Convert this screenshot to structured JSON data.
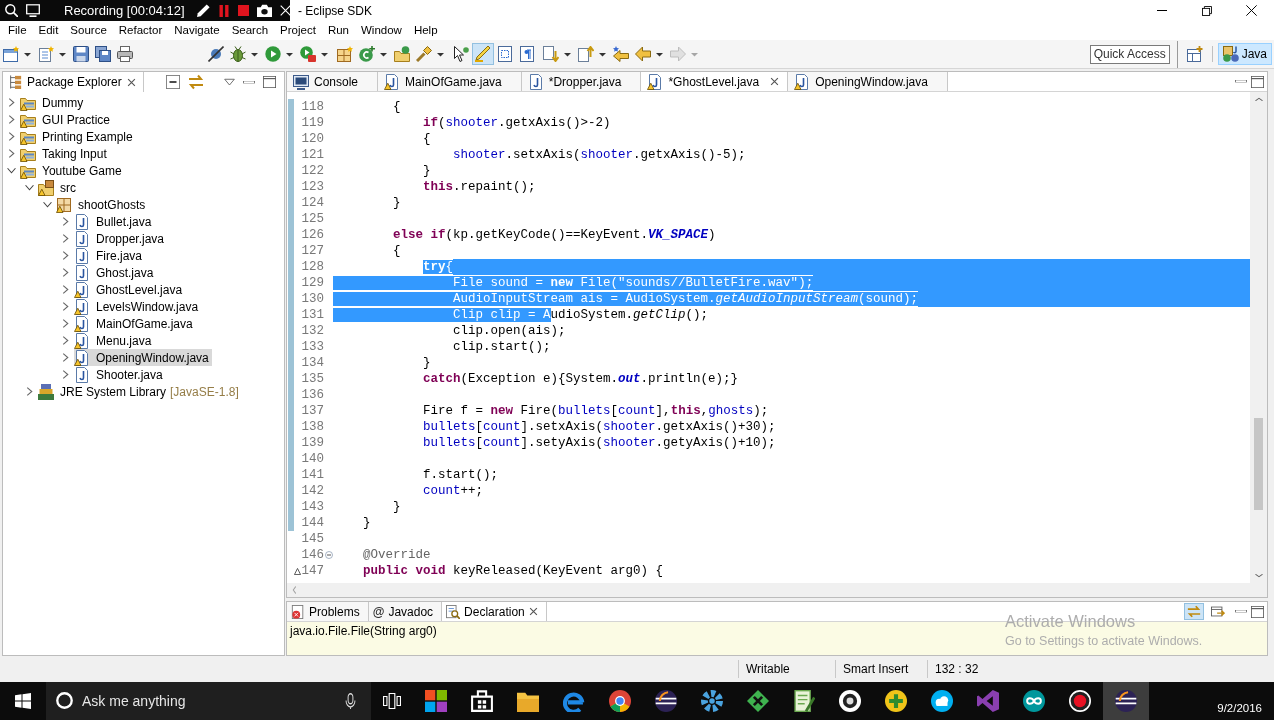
{
  "recorder": {
    "title": "Recording [00:04:12]"
  },
  "window": {
    "title": "- Eclipse SDK"
  },
  "menu": [
    "File",
    "Edit",
    "Source",
    "Refactor",
    "Navigate",
    "Search",
    "Project",
    "Run",
    "Window",
    "Help"
  ],
  "toolbar": [
    {
      "items": [
        {
          "kind": "new-wizard",
          "pressed": false,
          "disabled": false
        },
        {
          "kind": "new-file",
          "pressed": false,
          "disabled": false
        },
        {
          "kind": "save",
          "pressed": false,
          "disabled": false
        },
        {
          "kind": "save-all",
          "pressed": false,
          "disabled": false
        },
        {
          "kind": "print",
          "pressed": false,
          "disabled": false
        }
      ]
    },
    {
      "items": [
        {
          "kind": "skip-breakpoints",
          "pressed": false,
          "disabled": false
        },
        {
          "kind": "debug",
          "pressed": false,
          "disabled": false
        },
        {
          "kind": "run",
          "pressed": false,
          "disabled": false
        },
        {
          "kind": "external-tools",
          "pressed": false,
          "disabled": false
        }
      ]
    },
    {
      "items": [
        {
          "kind": "new-package",
          "pressed": false,
          "disabled": false
        },
        {
          "kind": "new-class",
          "pressed": false,
          "disabled": false
        },
        {
          "kind": "open-type",
          "pressed": false,
          "disabled": false
        },
        {
          "kind": "search",
          "pressed": false,
          "disabled": false
        }
      ]
    },
    {
      "items": [
        {
          "kind": "pointer",
          "pressed": false,
          "disabled": false
        },
        {
          "kind": "mark-occurrences",
          "pressed": true,
          "disabled": false
        },
        {
          "kind": "block-selection",
          "pressed": false,
          "disabled": false
        },
        {
          "kind": "whitespace",
          "pressed": false,
          "disabled": false
        }
      ]
    },
    {
      "items": [
        {
          "kind": "next-annotation",
          "pressed": false,
          "disabled": false
        },
        {
          "kind": "previous-annotation",
          "pressed": false,
          "disabled": false
        },
        {
          "kind": "last-edit",
          "pressed": false,
          "disabled": false
        },
        {
          "kind": "back",
          "pressed": false,
          "disabled": false
        },
        {
          "kind": "forward",
          "pressed": false,
          "disabled": true
        }
      ]
    }
  ],
  "quick_access": {
    "placeholder": "Quick Access"
  },
  "perspectives": [
    {
      "label": "Java",
      "selected": true
    }
  ],
  "package_explorer": {
    "title": "Package Explorer",
    "tree": [
      {
        "label": "Dummy",
        "kind": "project",
        "expanded": false,
        "selected": false,
        "warning": true
      },
      {
        "label": "GUI Practice",
        "kind": "project",
        "expanded": false,
        "selected": false,
        "warning": true
      },
      {
        "label": "Printing Example",
        "kind": "project",
        "expanded": false,
        "selected": false,
        "warning": true
      },
      {
        "label": "Taking Input",
        "kind": "project",
        "expanded": false,
        "selected": false,
        "warning": true
      },
      {
        "label": "Youtube Game",
        "kind": "project",
        "expanded": true,
        "selected": false,
        "warning": true,
        "children": [
          {
            "label": "src",
            "kind": "source-folder",
            "expanded": true,
            "selected": false,
            "warning": true,
            "children": [
              {
                "label": "shootGhosts",
                "kind": "package",
                "expanded": true,
                "selected": false,
                "warning": true,
                "children": [
                  {
                    "label": "Bullet.java",
                    "kind": "java-file",
                    "expanded": false,
                    "selected": false,
                    "warning": false
                  },
                  {
                    "label": "Dropper.java",
                    "kind": "java-file",
                    "expanded": false,
                    "selected": false,
                    "warning": false
                  },
                  {
                    "label": "Fire.java",
                    "kind": "java-file",
                    "expanded": false,
                    "selected": false,
                    "warning": false
                  },
                  {
                    "label": "Ghost.java",
                    "kind": "java-file",
                    "expanded": false,
                    "selected": false,
                    "warning": false
                  },
                  {
                    "label": "GhostLevel.java",
                    "kind": "java-file",
                    "expanded": false,
                    "selected": false,
                    "warning": true
                  },
                  {
                    "label": "LevelsWindow.java",
                    "kind": "java-file",
                    "expanded": false,
                    "selected": false,
                    "warning": true
                  },
                  {
                    "label": "MainOfGame.java",
                    "kind": "java-file",
                    "expanded": false,
                    "selected": false,
                    "warning": true
                  },
                  {
                    "label": "Menu.java",
                    "kind": "java-file",
                    "expanded": false,
                    "selected": false,
                    "warning": true
                  },
                  {
                    "label": "OpeningWindow.java",
                    "kind": "java-file",
                    "expanded": false,
                    "selected": true,
                    "warning": true
                  },
                  {
                    "label": "Shooter.java",
                    "kind": "java-file",
                    "expanded": false,
                    "selected": false,
                    "warning": false
                  }
                ]
              }
            ]
          },
          {
            "label": "JRE System Library",
            "decoration": "[JavaSE-1.8]",
            "kind": "library",
            "expanded": false,
            "selected": false,
            "warning": false
          }
        ]
      }
    ]
  },
  "editor": {
    "tabs": [
      {
        "label": "Console",
        "kind": "console",
        "warning": false,
        "selected": false
      },
      {
        "label": "MainOfGame.java",
        "kind": "java",
        "warning": true,
        "selected": false
      },
      {
        "label": "*Dropper.java",
        "kind": "java",
        "warning": false,
        "selected": false
      },
      {
        "label": "*GhostLevel.java",
        "kind": "java",
        "warning": true,
        "selected": true
      },
      {
        "label": "OpeningWindow.java",
        "kind": "java",
        "warning": true,
        "selected": false
      }
    ],
    "blocks": [
      {
        "range_marked": true,
        "lines": [
          {
            "number": "118",
            "fold_marker": false,
            "override_marker": false,
            "segments": [
              {
                "kind": "plain",
                "text": "\t\t{",
                "selected": false
              }
            ]
          },
          {
            "number": "119",
            "fold_marker": false,
            "override_marker": false,
            "segments": [
              {
                "kind": "keyword",
                "text": "\t\t\tif",
                "selected": false
              },
              {
                "kind": "plain",
                "text": "(",
                "selected": false
              },
              {
                "kind": "field",
                "text": "shooter",
                "selected": false
              },
              {
                "kind": "plain",
                "text": ".getxAxis()>-2)",
                "selected": false
              }
            ]
          },
          {
            "number": "120",
            "fold_marker": false,
            "override_marker": false,
            "segments": [
              {
                "kind": "plain",
                "text": "\t\t\t{",
                "selected": false
              }
            ]
          },
          {
            "number": "121",
            "fold_marker": false,
            "override_marker": false,
            "segments": [
              {
                "kind": "field",
                "text": "\t\t\t\tshooter",
                "selected": false
              },
              {
                "kind": "plain",
                "text": ".setxAxis(",
                "selected": false
              },
              {
                "kind": "field",
                "text": "shooter",
                "selected": false
              },
              {
                "kind": "plain",
                "text": ".getxAxis()-5);",
                "selected": false
              }
            ]
          },
          {
            "number": "122",
            "fold_marker": false,
            "override_marker": false,
            "segments": [
              {
                "kind": "plain",
                "text": "\t\t\t}",
                "selected": false
              }
            ]
          },
          {
            "number": "123",
            "fold_marker": false,
            "override_marker": false,
            "segments": [
              {
                "kind": "keyword",
                "text": "\t\t\tthis",
                "selected": false
              },
              {
                "kind": "plain",
                "text": ".repaint();",
                "selected": false
              }
            ]
          },
          {
            "number": "124",
            "fold_marker": false,
            "override_marker": false,
            "segments": [
              {
                "kind": "plain",
                "text": "\t\t}",
                "selected": false
              }
            ]
          },
          {
            "number": "125",
            "fold_marker": false,
            "override_marker": false
          },
          {
            "number": "126",
            "fold_marker": false,
            "override_marker": false,
            "segments": [
              {
                "kind": "keyword",
                "text": "\t\telse if",
                "selected": false
              },
              {
                "kind": "plain",
                "text": "(kp.getKeyCode()==KeyEvent.",
                "selected": false
              },
              {
                "kind": "static-field",
                "text": "VK_SPACE",
                "selected": false
              },
              {
                "kind": "plain",
                "text": ")",
                "selected": false
              }
            ]
          },
          {
            "number": "127",
            "fold_marker": false,
            "override_marker": false,
            "segments": [
              {
                "kind": "plain",
                "text": "\t\t{",
                "selected": false
              }
            ]
          },
          {
            "number": "128",
            "fold_marker": false,
            "override_marker": false,
            "segments": [
              {
                "kind": "keyword",
                "text": "\t\t\ttry",
                "selected": true
              },
              {
                "kind": "plain",
                "text": "{",
                "selected": true
              }
            ]
          },
          {
            "number": "129",
            "fold_marker": false,
            "override_marker": false,
            "segments": [
              {
                "kind": "plain",
                "text": "\t\t\t\tFile sound = ",
                "selected": true
              },
              {
                "kind": "keyword",
                "text": "new",
                "selected": true
              },
              {
                "kind": "plain",
                "text": " File(",
                "selected": true
              },
              {
                "kind": "string",
                "text": "\"sounds//BulletFire.wav\"",
                "selected": true
              },
              {
                "kind": "plain",
                "text": ");",
                "selected": true
              }
            ]
          },
          {
            "number": "130",
            "fold_marker": false,
            "override_marker": false,
            "segments": [
              {
                "kind": "plain",
                "text": "\t\t\t\tAudioInputStream ais = AudioSystem.",
                "selected": true
              },
              {
                "kind": "static-method",
                "text": "getAudioInputStream",
                "selected": true
              },
              {
                "kind": "plain",
                "text": "(sound);",
                "selected": true
              }
            ]
          },
          {
            "number": "131",
            "fold_marker": false,
            "override_marker": false,
            "segments": [
              {
                "kind": "plain",
                "text": "\t\t\t\tClip clip = A",
                "selected": true
              },
              {
                "kind": "plain",
                "text": "udioSystem.",
                "selected": false
              },
              {
                "kind": "static-method",
                "text": "getClip",
                "selected": false
              },
              {
                "kind": "plain",
                "text": "();",
                "selected": false
              }
            ]
          },
          {
            "number": "132",
            "fold_marker": false,
            "override_marker": false,
            "segments": [
              {
                "kind": "plain",
                "text": "\t\t\t\tclip.open(ais);",
                "selected": false
              }
            ]
          },
          {
            "number": "133",
            "fold_marker": false,
            "override_marker": false,
            "segments": [
              {
                "kind": "plain",
                "text": "\t\t\t\tclip.start();",
                "selected": false
              }
            ]
          },
          {
            "number": "134",
            "fold_marker": false,
            "override_marker": false,
            "segments": [
              {
                "kind": "plain",
                "text": "\t\t\t}",
                "selected": false
              }
            ]
          },
          {
            "number": "135",
            "fold_marker": false,
            "override_marker": false,
            "segments": [
              {
                "kind": "keyword",
                "text": "\t\t\tcatch",
                "selected": false
              },
              {
                "kind": "plain",
                "text": "(Exception e){System.",
                "selected": false
              },
              {
                "kind": "static-field",
                "text": "out",
                "selected": false
              },
              {
                "kind": "plain",
                "text": ".println(e);}",
                "selected": false
              }
            ]
          },
          {
            "number": "136",
            "fold_marker": false,
            "override_marker": false
          },
          {
            "number": "137",
            "fold_marker": false,
            "override_marker": false,
            "segments": [
              {
                "kind": "plain",
                "text": "\t\t\tFire f = ",
                "selected": false
              },
              {
                "kind": "keyword",
                "text": "new",
                "selected": false
              },
              {
                "kind": "plain",
                "text": " Fire(",
                "selected": false
              },
              {
                "kind": "field",
                "text": "bullets",
                "selected": false
              },
              {
                "kind": "plain",
                "text": "[",
                "selected": false
              },
              {
                "kind": "field",
                "text": "count",
                "selected": false
              },
              {
                "kind": "plain",
                "text": "],",
                "selected": false
              },
              {
                "kind": "keyword",
                "text": "this",
                "selected": false
              },
              {
                "kind": "plain",
                "text": ",",
                "selected": false
              },
              {
                "kind": "field",
                "text": "ghosts",
                "selected": false
              },
              {
                "kind": "plain",
                "text": ");",
                "selected": false
              }
            ]
          },
          {
            "number": "138",
            "fold_marker": false,
            "override_marker": false,
            "segments": [
              {
                "kind": "field",
                "text": "\t\t\tbullets",
                "selected": false
              },
              {
                "kind": "plain",
                "text": "[",
                "selected": false
              },
              {
                "kind": "field",
                "text": "count",
                "selected": false
              },
              {
                "kind": "plain",
                "text": "].setxAxis(",
                "selected": false
              },
              {
                "kind": "field",
                "text": "shooter",
                "selected": false
              },
              {
                "kind": "plain",
                "text": ".getxAxis()+30);",
                "selected": false
              }
            ]
          },
          {
            "number": "139",
            "fold_marker": false,
            "override_marker": false,
            "segments": [
              {
                "kind": "field",
                "text": "\t\t\tbullets",
                "selected": false
              },
              {
                "kind": "plain",
                "text": "[",
                "selected": false
              },
              {
                "kind": "field",
                "text": "count",
                "selected": false
              },
              {
                "kind": "plain",
                "text": "].setyAxis(",
                "selected": false
              },
              {
                "kind": "field",
                "text": "shooter",
                "selected": false
              },
              {
                "kind": "plain",
                "text": ".getyAxis()+10);",
                "selected": false
              }
            ]
          },
          {
            "number": "140",
            "fold_marker": false,
            "override_marker": false
          },
          {
            "number": "141",
            "fold_marker": false,
            "override_marker": false,
            "segments": [
              {
                "kind": "plain",
                "text": "\t\t\tf.start();",
                "selected": false
              }
            ]
          },
          {
            "number": "142",
            "fold_marker": false,
            "override_marker": false,
            "segments": [
              {
                "kind": "field",
                "text": "\t\t\tcount",
                "selected": false
              },
              {
                "kind": "plain",
                "text": "++;",
                "selected": false
              }
            ]
          },
          {
            "number": "143",
            "fold_marker": false,
            "override_marker": false,
            "segments": [
              {
                "kind": "plain",
                "text": "\t\t}",
                "selected": false
              }
            ]
          },
          {
            "number": "144",
            "fold_marker": false,
            "override_marker": false,
            "segments": [
              {
                "kind": "plain",
                "text": "\t}",
                "selected": false
              }
            ]
          }
        ]
      },
      {
        "range_marked": false,
        "lines": [
          {
            "number": "145",
            "fold_marker": false,
            "override_marker": false
          },
          {
            "number": "146",
            "fold_marker": true,
            "override_marker": false,
            "segments": [
              {
                "kind": "annotation",
                "text": "\t@Override",
                "selected": false
              }
            ]
          },
          {
            "number": "147",
            "fold_marker": false,
            "override_marker": true,
            "segments": [
              {
                "kind": "keyword",
                "text": "\tpublic void",
                "selected": false
              },
              {
                "kind": "plain",
                "text": " keyReleased(KeyEvent arg0) {",
                "selected": false
              }
            ]
          }
        ]
      }
    ]
  },
  "bottom_panel": {
    "tabs": [
      {
        "label": "Problems",
        "kind": "problems",
        "selected": false
      },
      {
        "label": "Javadoc",
        "kind": "javadoc",
        "glyph": "@",
        "selected": false
      },
      {
        "label": "Declaration",
        "kind": "declaration",
        "selected": true
      }
    ],
    "tools": [
      {
        "kind": "link",
        "pressed": true
      },
      {
        "kind": "open-input",
        "pressed": false
      }
    ],
    "content": "java.io.File.File(String arg0)"
  },
  "status_bar": {
    "fields": [
      "Writable",
      "Smart Insert",
      "132 : 32"
    ]
  },
  "activation_notice": {
    "title": "Activate Windows",
    "hint": "Go to Settings to activate Windows."
  },
  "taskbar": {
    "search": {
      "placeholder": "Ask me anything"
    },
    "apps": [
      {
        "kind": "color-tiles",
        "active": false
      },
      {
        "kind": "bag",
        "active": false
      },
      {
        "kind": "folder",
        "active": false
      },
      {
        "kind": "swirl",
        "active": false
      },
      {
        "kind": "segmented-circle",
        "active": false
      },
      {
        "kind": "striped-sphere",
        "active": false
      },
      {
        "kind": "cog",
        "active": false
      },
      {
        "kind": "diamond",
        "active": false
      },
      {
        "kind": "notepad",
        "active": false
      },
      {
        "kind": "lens",
        "active": false
      },
      {
        "kind": "plus",
        "active": false
      },
      {
        "kind": "cloud-badge",
        "active": false
      },
      {
        "kind": "ribbon",
        "active": false
      },
      {
        "kind": "infinity",
        "active": false
      },
      {
        "kind": "record",
        "active": false
      },
      {
        "kind": "striped-sphere",
        "active": true
      }
    ],
    "date": "9/2/2016"
  }
}
